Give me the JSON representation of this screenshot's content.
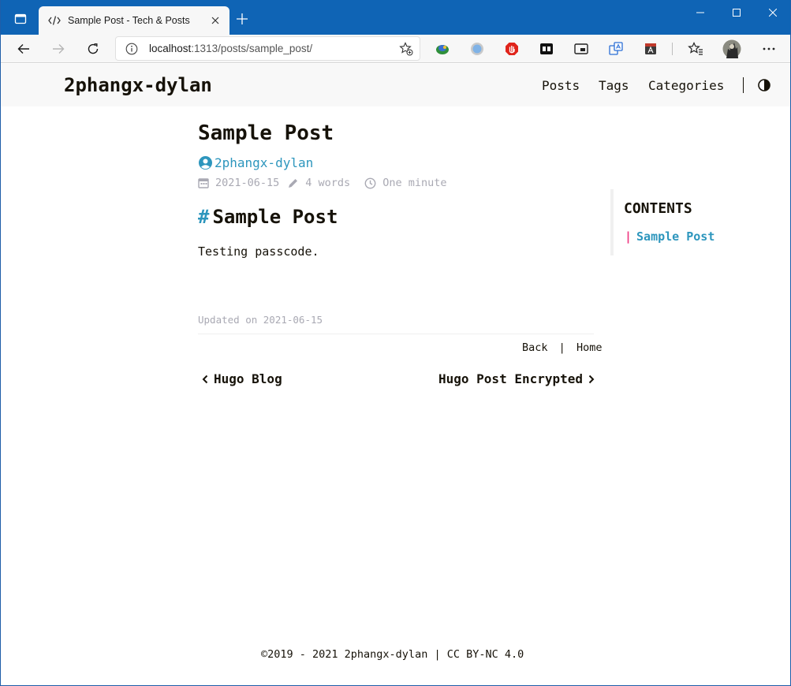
{
  "browser": {
    "tab_title": "Sample Post - Tech & Posts",
    "url_host": "localhost",
    "url_rest": ":1313/posts/sample_post/",
    "accent": "#0f64b5"
  },
  "site": {
    "title": "2phangx-dylan",
    "menu": [
      "Posts",
      "Tags",
      "Categories"
    ]
  },
  "post": {
    "title": "Sample Post",
    "author": "2phangx-dylan",
    "date": "2021-06-15",
    "words": "4 words",
    "reading_time": "One minute",
    "heading_hash": "#",
    "heading": "Sample Post",
    "body": "Testing passcode.",
    "updated": "Updated on 2021-06-15"
  },
  "toc": {
    "title": "CONTENTS",
    "marker": "|",
    "items": [
      "Sample Post"
    ]
  },
  "post_nav": {
    "back": "Back",
    "separator": "|",
    "home": "Home",
    "prev": "Hugo Blog",
    "next": "Hugo Post Encrypted"
  },
  "footer": {
    "text": "©2019 - 2021 2phangx-dylan | CC BY-NC 4.0"
  },
  "colors": {
    "link": "#2d96bd",
    "meta": "#a9a9b3",
    "toc_marker": "#ef3982"
  }
}
